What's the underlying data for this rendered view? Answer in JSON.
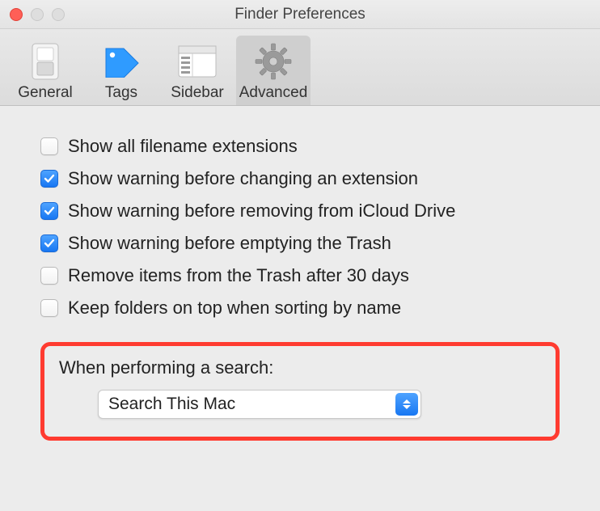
{
  "window": {
    "title": "Finder Preferences"
  },
  "toolbar": {
    "tabs": [
      {
        "label": "General"
      },
      {
        "label": "Tags"
      },
      {
        "label": "Sidebar"
      },
      {
        "label": "Advanced"
      }
    ]
  },
  "options": [
    {
      "checked": false,
      "label": "Show all filename extensions"
    },
    {
      "checked": true,
      "label": "Show warning before changing an extension"
    },
    {
      "checked": true,
      "label": "Show warning before removing from iCloud Drive"
    },
    {
      "checked": true,
      "label": "Show warning before emptying the Trash"
    },
    {
      "checked": false,
      "label": "Remove items from the Trash after 30 days"
    },
    {
      "checked": false,
      "label": "Keep folders on top when sorting by name"
    }
  ],
  "search": {
    "label": "When performing a search:",
    "selected": "Search This Mac"
  }
}
